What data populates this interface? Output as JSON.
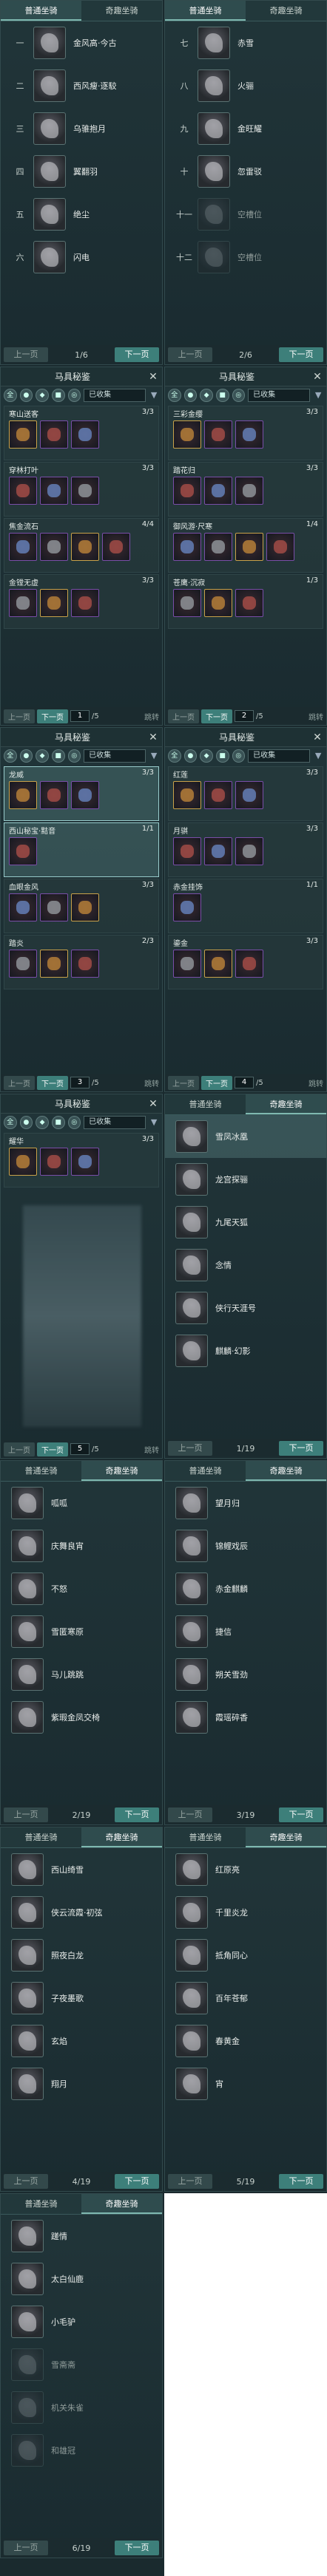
{
  "tabs": {
    "normal": "普通坐骑",
    "fancy": "奇趣坐骑"
  },
  "pager": {
    "prev": "上一页",
    "next": "下一页"
  },
  "p1": {
    "page": "1/6",
    "rows": [
      [
        "一",
        "金风高·今古"
      ],
      [
        "二",
        "西风瘦·逐駮"
      ],
      [
        "三",
        "乌骓抱月"
      ],
      [
        "四",
        "翼翻羽"
      ],
      [
        "五",
        "绝尘"
      ],
      [
        "六",
        "闪电"
      ]
    ]
  },
  "p2": {
    "page": "2/6",
    "rows": [
      [
        "七",
        "赤雪"
      ],
      [
        "八",
        "火骊"
      ],
      [
        "九",
        "金旺耀"
      ],
      [
        "十",
        "忽雷驳"
      ],
      [
        "十一",
        "空槽位"
      ],
      [
        "十二",
        "空槽位"
      ]
    ]
  },
  "gear": {
    "title": "马具秘鉴",
    "select": "已收集",
    "jump": "跳转",
    "p1": "1",
    "p2": "2",
    "p3": "3",
    "p4": "4",
    "p5": "5",
    "total": "/5"
  },
  "setA": [
    {
      "name": "寒山送客",
      "count": "3/3"
    },
    {
      "name": "穿林打叶",
      "count": "3/3"
    },
    {
      "name": "焦金流石",
      "count": "4/4"
    },
    {
      "name": "金镗无虚",
      "count": "3/3"
    }
  ],
  "setB": [
    {
      "name": "三彩金缨",
      "count": "3/3"
    },
    {
      "name": "踏花归",
      "count": "3/3"
    },
    {
      "name": "御风游·尺寒",
      "count": "1/4"
    },
    {
      "name": "苍鹰·沉寂",
      "count": "1/3"
    }
  ],
  "setC": [
    {
      "name": "龙威",
      "count": "3/3"
    },
    {
      "name": "西山秘宝·黠音",
      "count": "1/1"
    },
    {
      "name": "血眼金风",
      "count": "3/3"
    },
    {
      "name": "踏炎",
      "count": "2/3"
    }
  ],
  "setD": [
    {
      "name": "红莲",
      "count": "3/3"
    },
    {
      "name": "月骐",
      "count": "3/3"
    },
    {
      "name": "赤金挂饰",
      "count": "1/1"
    },
    {
      "name": "鎏金",
      "count": "3/3"
    }
  ],
  "setE": [
    {
      "name": "耀华",
      "count": "3/3"
    }
  ],
  "f1": {
    "page": "1/19",
    "rows": [
      "雪凤冰凰",
      "龙宫探骊",
      "九尾天狐",
      "念情",
      "侠行天涯号",
      "麒麟·幻影"
    ]
  },
  "f2": {
    "page": "2/19",
    "rows": [
      "呱呱",
      "庆舞良宵",
      "不怒",
      "雪匿寒原",
      "马儿跳跳",
      "紫瑕金凤交椅"
    ]
  },
  "f3": {
    "page": "3/19",
    "rows": [
      "望月归",
      "锦鲤戏辰",
      "赤金麒麟",
      "捷信",
      "朔关雪劲",
      "霞瑶碎香"
    ]
  },
  "f4": {
    "page": "4/19",
    "rows": [
      "西山绮雪",
      "侠云流霞·初弦",
      "照夜白龙",
      "子夜墨歌",
      "玄焰",
      "翔月"
    ]
  },
  "f5": {
    "page": "5/19",
    "rows": [
      "红原亮",
      "千里炎龙",
      "抵角同心",
      "百年苍郁",
      "春黄金",
      "宵"
    ]
  },
  "f6": {
    "page": "6/19",
    "rows": [
      "蹉情",
      "太白仙鹿",
      "小毛驴",
      "雪斋斋",
      "机关朱雀",
      "和雄冠"
    ]
  }
}
